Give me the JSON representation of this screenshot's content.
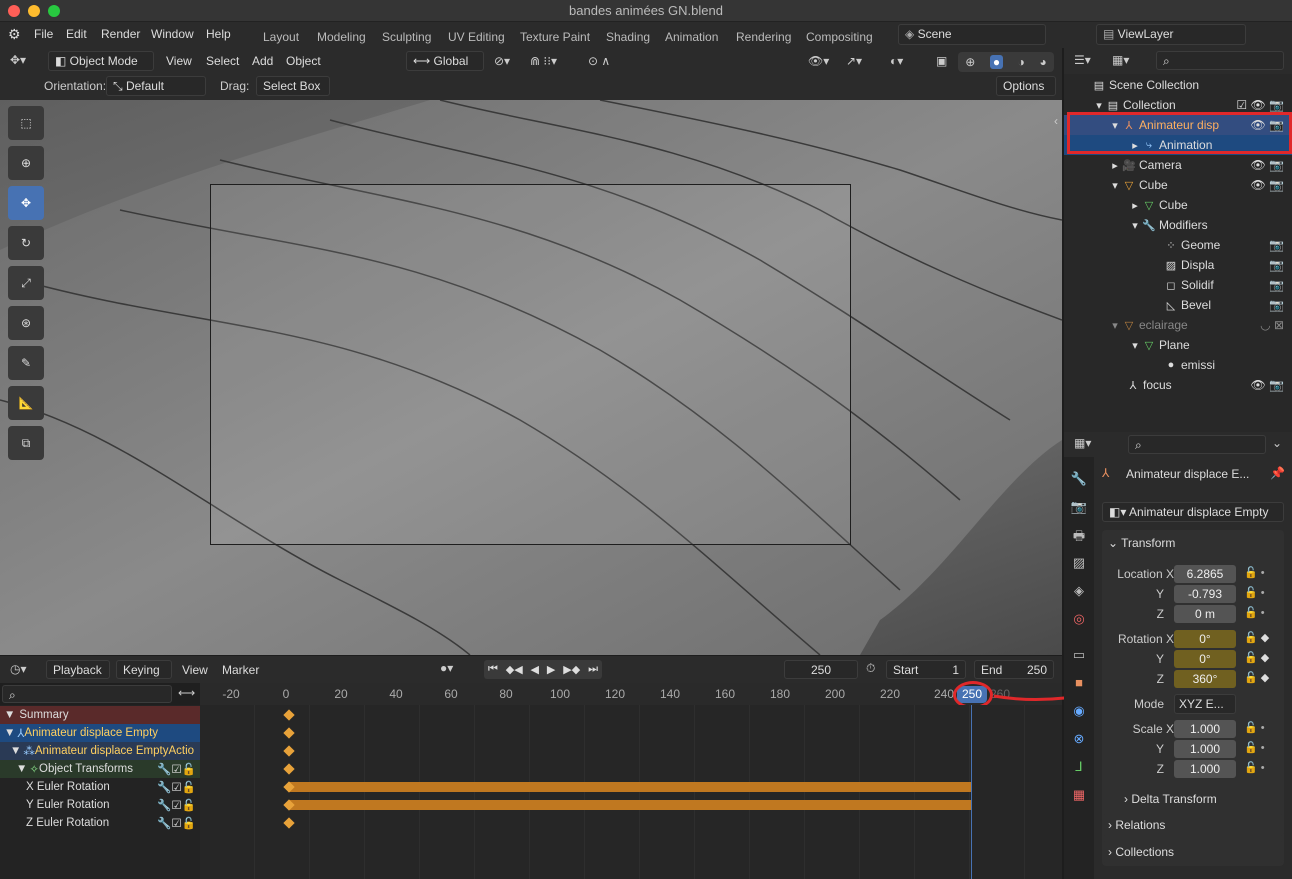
{
  "window": {
    "title": "bandes animées GN.blend"
  },
  "menu": {
    "items": [
      "File",
      "Edit",
      "Render",
      "Window",
      "Help"
    ]
  },
  "workspaces": [
    "Layout",
    "Modeling",
    "Sculpting",
    "UV Editing",
    "Texture Paint",
    "Shading",
    "Animation",
    "Rendering",
    "Compositing"
  ],
  "scene": {
    "name": "Scene",
    "view_layer": "ViewLayer"
  },
  "viewport_header": {
    "mode": "Object Mode",
    "menus": [
      "View",
      "Select",
      "Add",
      "Object"
    ],
    "transform_orientation": "Global",
    "orientation_label": "Orientation:",
    "orientation_value": "Default",
    "drag_label": "Drag:",
    "drag_value": "Select Box",
    "options_label": "Options"
  },
  "tools": [
    "select-box-icon",
    "cursor-icon",
    "move-icon",
    "rotate-icon",
    "scale-icon",
    "transform-icon",
    "annotate-icon",
    "measure-icon",
    "add-cube-icon"
  ],
  "timeline": {
    "menus": [
      "Playback",
      "Keying",
      "View",
      "Marker"
    ],
    "current_frame": "250",
    "start_label": "Start",
    "start": "1",
    "end_label": "End",
    "end": "250",
    "ruler": [
      "-20",
      "0",
      "20",
      "40",
      "60",
      "80",
      "100",
      "120",
      "140",
      "160",
      "180",
      "200",
      "220",
      "240",
      "250",
      "260"
    ],
    "channels": [
      {
        "label": "Summary",
        "indent": 0
      },
      {
        "label": "Animateur displace Empty",
        "indent": 1
      },
      {
        "label": "Animateur displace EmptyActio",
        "indent": 2
      },
      {
        "label": "Object Transforms",
        "indent": 3
      },
      {
        "label": "X Euler Rotation",
        "indent": 4
      },
      {
        "label": "Y Euler Rotation",
        "indent": 4
      },
      {
        "label": "Z Euler Rotation",
        "indent": 4
      }
    ]
  },
  "outliner": {
    "rows": [
      {
        "label": "Scene Collection",
        "indent": 0
      },
      {
        "label": "Collection",
        "indent": 1
      },
      {
        "label": "Animateur disp",
        "indent": 2
      },
      {
        "label": "Animation",
        "indent": 3
      },
      {
        "label": "Camera",
        "indent": 2
      },
      {
        "label": "Cube",
        "indent": 2
      },
      {
        "label": "Cube",
        "indent": 3
      },
      {
        "label": "Modifiers",
        "indent": 3
      },
      {
        "label": "Geome",
        "indent": 4
      },
      {
        "label": "Displa",
        "indent": 4
      },
      {
        "label": "Solidif",
        "indent": 4
      },
      {
        "label": "Bevel",
        "indent": 4
      },
      {
        "label": "eclairage",
        "indent": 2
      },
      {
        "label": "Plane",
        "indent": 3
      },
      {
        "label": "emissi",
        "indent": 4
      },
      {
        "label": "focus",
        "indent": 2
      }
    ]
  },
  "properties": {
    "object_header": "Animateur displace E...",
    "object_name": "Animateur displace Empty",
    "transform_label": "Transform",
    "location_label": "Location X",
    "location": [
      "6.2865",
      "-0.793",
      "0 m"
    ],
    "rotation_label": "Rotation X",
    "rotation": [
      "0°",
      "0°",
      "360°"
    ],
    "mode_label": "Mode",
    "mode_value": "XYZ E...",
    "scale_label": "Scale X",
    "scale": [
      "1.000",
      "1.000",
      "1.000"
    ],
    "axis_y": "Y",
    "axis_z": "Z",
    "sections": [
      "Delta Transform",
      "Relations",
      "Collections"
    ]
  },
  "colors": {
    "accent": "#4772b3",
    "highlight": "#e0282a",
    "keyframe": "#e8a23a"
  }
}
